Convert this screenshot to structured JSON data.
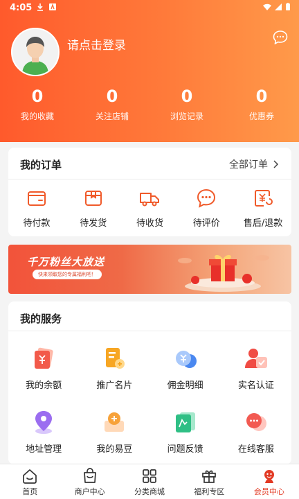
{
  "status_bar": {
    "time": "4:05"
  },
  "profile": {
    "login_prompt": "请点击登录"
  },
  "stats": [
    {
      "value": "0",
      "label": "我的收藏"
    },
    {
      "value": "0",
      "label": "关注店铺"
    },
    {
      "value": "0",
      "label": "浏览记录"
    },
    {
      "value": "0",
      "label": "优惠券"
    }
  ],
  "orders": {
    "title": "我的订单",
    "all_label": "全部订单",
    "items": [
      {
        "label": "待付款",
        "icon": "wallet-icon"
      },
      {
        "label": "待发货",
        "icon": "package-icon"
      },
      {
        "label": "待收货",
        "icon": "truck-icon"
      },
      {
        "label": "待评价",
        "icon": "comment-icon"
      },
      {
        "label": "售后/退款",
        "icon": "refund-icon"
      }
    ]
  },
  "banner": {
    "title": "千万粉丝大放送",
    "subtitle": "快来领取您的专属福利吧！"
  },
  "services": {
    "title": "我的服务",
    "items": [
      {
        "label": "我的余额",
        "icon": "balance-icon"
      },
      {
        "label": "推广名片",
        "icon": "promo-card-icon"
      },
      {
        "label": "佣金明细",
        "icon": "commission-icon"
      },
      {
        "label": "实名认证",
        "icon": "verify-icon"
      },
      {
        "label": "地址管理",
        "icon": "location-icon"
      },
      {
        "label": "我的易豆",
        "icon": "bean-icon"
      },
      {
        "label": "问题反馈",
        "icon": "feedback-icon"
      },
      {
        "label": "在线客服",
        "icon": "service-icon"
      }
    ]
  },
  "tabbar": [
    {
      "label": "首页",
      "icon": "home-icon"
    },
    {
      "label": "商户中心",
      "icon": "bag-icon"
    },
    {
      "label": "分类商城",
      "icon": "grid-icon"
    },
    {
      "label": "福利专区",
      "icon": "gift-icon"
    },
    {
      "label": "会员中心",
      "icon": "member-icon",
      "active": true
    }
  ],
  "colors": {
    "accent": "#ff5a2c",
    "accent_light": "#ff9a4a",
    "active_tab": "#e23a24"
  }
}
